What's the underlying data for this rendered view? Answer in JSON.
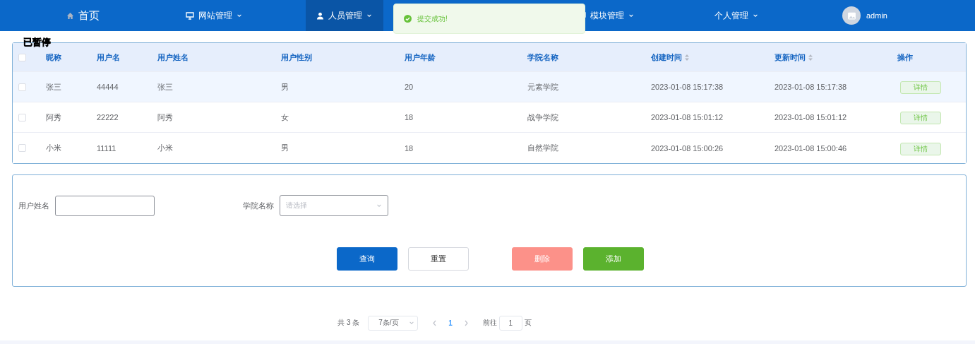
{
  "nav": {
    "items": [
      {
        "label": "首页",
        "selected": false,
        "dropdown": false
      },
      {
        "label": "网站管理",
        "selected": false,
        "dropdown": true
      },
      {
        "label": "人员管理",
        "selected": true,
        "dropdown": true
      },
      {
        "label": "模块管理",
        "selected": false,
        "dropdown": true
      },
      {
        "label": "个人管理",
        "selected": false,
        "dropdown": true
      }
    ],
    "user": "admin"
  },
  "toast": {
    "message": "提交成功!"
  },
  "overlay": {
    "text": "已暂停"
  },
  "table": {
    "all_checked": false,
    "columns": [
      {
        "label": "昵称",
        "sortable": false
      },
      {
        "label": "用户名",
        "sortable": false
      },
      {
        "label": "用户姓名",
        "sortable": false
      },
      {
        "label": "用户性别",
        "sortable": false
      },
      {
        "label": "用户年龄",
        "sortable": false
      },
      {
        "label": "学院名称",
        "sortable": false
      },
      {
        "label": "创建时间",
        "sortable": true
      },
      {
        "label": "更新时间",
        "sortable": true
      },
      {
        "label": "操作",
        "sortable": false
      }
    ],
    "rows": [
      {
        "cells": [
          "张三",
          "44444",
          "张三",
          "男",
          "20",
          "元素学院",
          "2023-01-08 15:17:38",
          "2023-01-08 15:17:38"
        ],
        "action": "详情",
        "checked": false,
        "hovered": true
      },
      {
        "cells": [
          "阿秀",
          "22222",
          "阿秀",
          "女",
          "18",
          "战争学院",
          "2023-01-08 15:01:12",
          "2023-01-08 15:01:12"
        ],
        "action": "详情",
        "checked": false,
        "hovered": false
      },
      {
        "cells": [
          "小米",
          "11111",
          "小米",
          "男",
          "18",
          "自然学院",
          "2023-01-08 15:00:26",
          "2023-01-08 15:00:46"
        ],
        "action": "详情",
        "checked": false,
        "hovered": false
      }
    ]
  },
  "search": {
    "name_label": "用户姓名",
    "college_label": "学院名称",
    "college_placeholder": "请选择",
    "buttons": [
      {
        "label": "查询",
        "kind": "primary"
      },
      {
        "label": "重置",
        "kind": "default"
      },
      {
        "label": "删除",
        "kind": "danger"
      },
      {
        "label": "添加",
        "kind": "success"
      }
    ]
  },
  "pagination": {
    "total": "共 3 条",
    "page_size": "7条/页",
    "pages": [
      {
        "label": "1",
        "selected": true
      }
    ],
    "goto_label": "前往",
    "goto_value": "1",
    "page_suffix": "页"
  }
}
